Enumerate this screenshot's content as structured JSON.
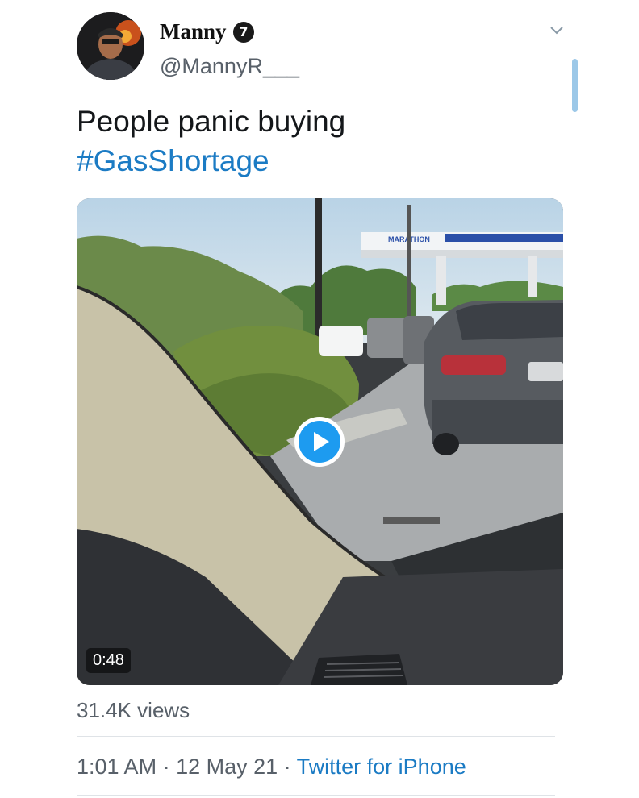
{
  "user": {
    "display_name": "Manny",
    "badge_number": "7",
    "handle": "@MannyR___"
  },
  "tweet": {
    "text": "People panic buying",
    "hashtag": "#GasShortage"
  },
  "media": {
    "station_sign": "MARATHON",
    "duration": "0:48"
  },
  "stats": {
    "views": "31.4K views"
  },
  "meta": {
    "time": "1:01 AM",
    "separator": " · ",
    "date": "12 May 21",
    "source": "Twitter for iPhone"
  },
  "colors": {
    "link": "#1b7bc4",
    "play_button": "#1d9bf0",
    "secondary_text": "#586069"
  },
  "icons": [
    "chevron-down-icon",
    "play-icon",
    "badge-icon"
  ]
}
